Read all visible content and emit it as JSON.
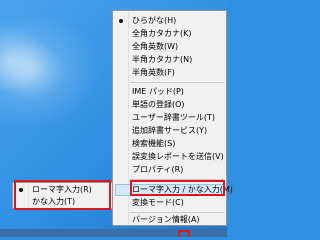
{
  "main_menu": {
    "items": [
      {
        "label": "ひらがな(H)",
        "selected": true
      },
      {
        "label": "全角カタカナ(K)"
      },
      {
        "label": "全角英数(W)"
      },
      {
        "label": "半角カタカナ(N)"
      },
      {
        "label": "半角英数(F)"
      },
      {
        "label": "IME パッド(P)"
      },
      {
        "label": "単語の登録(O)"
      },
      {
        "label": "ユーザー辞書ツール(T)"
      },
      {
        "label": "追加辞書サービス(Y)"
      },
      {
        "label": "検索機能(S)"
      },
      {
        "label": "誤変換レポートを送信(V)"
      },
      {
        "label": "プロパティ(R)"
      },
      {
        "label": "ローマ字入力 / かな入力(M)",
        "highlighted": true
      },
      {
        "label": "変換モード(C)"
      },
      {
        "label": "バージョン情報(A)"
      }
    ]
  },
  "sub_menu": {
    "items": [
      {
        "label": "ローマ字入力(R)",
        "selected": true
      },
      {
        "label": "かな入力(T)"
      }
    ]
  },
  "colors": {
    "highlight_box": "#d6191c",
    "hover": "#d6e9fb"
  }
}
